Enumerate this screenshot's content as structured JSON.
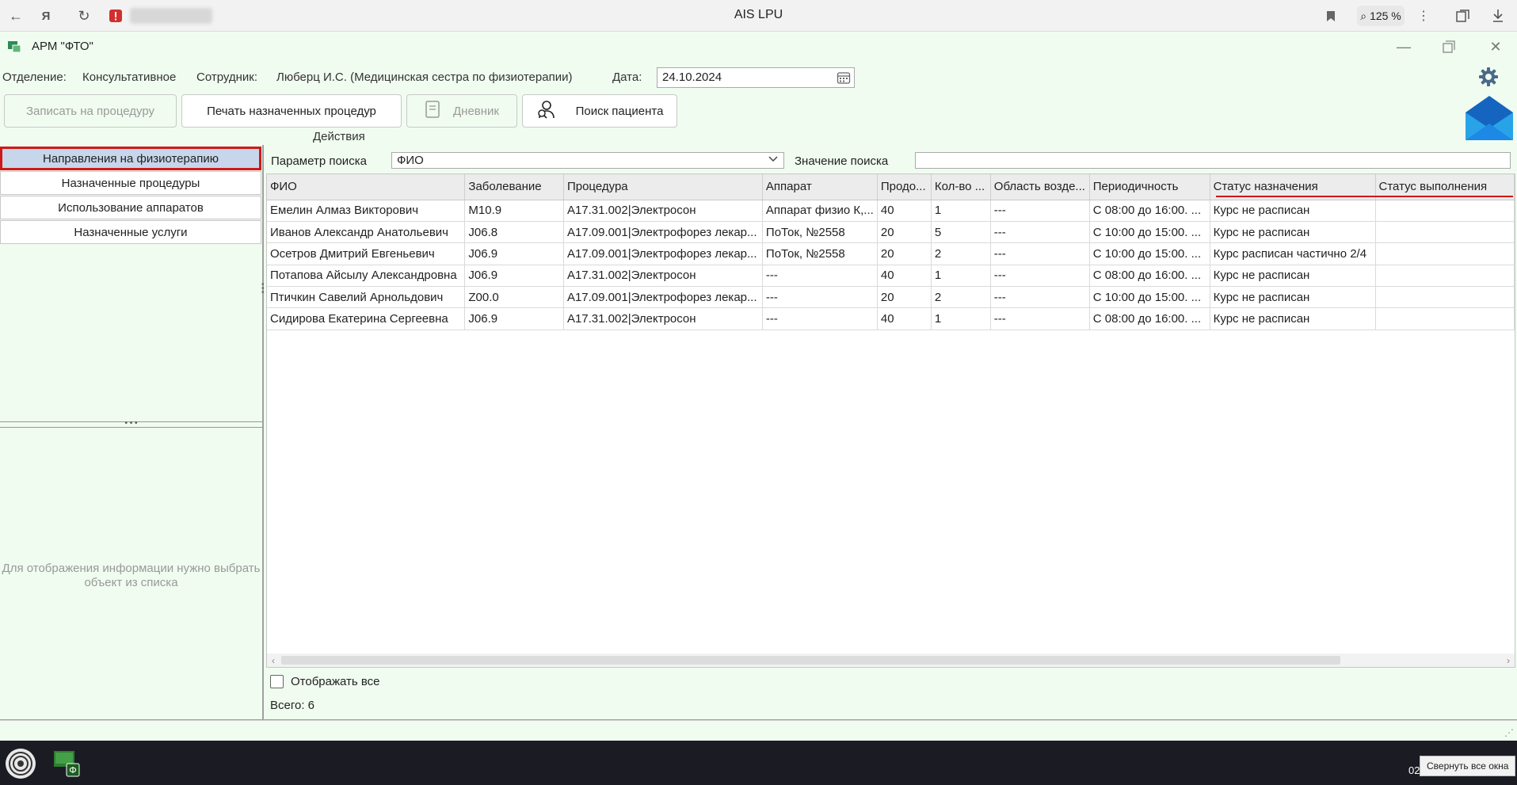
{
  "browser": {
    "title": "AIS LPU",
    "zoom": "125 %"
  },
  "app": {
    "title": "АРМ \"ФТО\""
  },
  "info": {
    "department_label": "Отделение:",
    "department_value": "Консультативное",
    "employee_label": "Сотрудник:",
    "employee_value": "Люберц И.С. (Медицинская сестра по физиотерапии)",
    "date_label": "Дата:",
    "date_value": "24.10.2024"
  },
  "toolbar": {
    "schedule_label": "Записать на процедуру",
    "print_label": "Печать назначенных процедур",
    "diary_label": "Дневник",
    "search_patient_label": "Поиск пациента",
    "group_label": "Действия"
  },
  "nav": {
    "items": [
      {
        "label": "Направления на физиотерапию"
      },
      {
        "label": "Назначенные процедуры"
      },
      {
        "label": "Использование аппаратов"
      },
      {
        "label": "Назначенные услуги"
      }
    ]
  },
  "detail": {
    "hint": "Для отображения информации нужно выбрать объект из списка"
  },
  "search": {
    "param_label": "Параметр поиска",
    "param_value": "ФИО",
    "value_label": "Значение поиска",
    "value": ""
  },
  "table": {
    "columns": [
      "ФИО",
      "Заболевание",
      "Процедура",
      "Аппарат",
      "Продо...",
      "Кол-во ...",
      "Область возде...",
      "Периодичность",
      "Статус назначения",
      "Статус выполнения"
    ],
    "rows": [
      [
        "Емелин Алмаз Викторович",
        "M10.9",
        "A17.31.002|Электросон",
        "Аппарат физио К,...",
        "40",
        "1",
        "---",
        "С 08:00 до 16:00. ...",
        "Курс не расписан",
        ""
      ],
      [
        "Иванов Александр Анатольевич",
        "J06.8",
        "A17.09.001|Электрофорез лекар...",
        "ПоТок, №2558",
        "20",
        "5",
        "---",
        "С 10:00 до 15:00. ...",
        "Курс не расписан",
        ""
      ],
      [
        "Осетров Дмитрий Евгеньевич",
        "J06.9",
        "A17.09.001|Электрофорез лекар...",
        "ПоТок, №2558",
        "20",
        "2",
        "---",
        "С 10:00 до 15:00. ...",
        "Курс расписан частично 2/4",
        ""
      ],
      [
        "Потапова Айсылу Александровна",
        "J06.9",
        "A17.31.002|Электросон",
        "---",
        "40",
        "1",
        "---",
        "С 08:00 до 16:00. ...",
        "Курс не расписан",
        ""
      ],
      [
        "Птичкин Савелий Арнольдович",
        "Z00.0",
        "A17.09.001|Электрофорез лекар...",
        "---",
        "20",
        "2",
        "---",
        "С 10:00 до 15:00. ...",
        "Курс не расписан",
        ""
      ],
      [
        "Сидирова Екатерина Сергеевна",
        "J06.9",
        "A17.31.002|Электросон",
        "---",
        "40",
        "1",
        "---",
        "С 08:00 до 16:00. ...",
        "Курс не расписан",
        ""
      ]
    ]
  },
  "footer": {
    "show_all_label": "Отображать все",
    "total_label": "Всего:  6"
  },
  "taskbar": {
    "hide_all_label": "Свернуть все окна",
    "clock": "02"
  },
  "colors": {
    "app_background": "#f0fcf0",
    "active_nav_fill": "#c7d6ea",
    "highlight_red": "#d01818"
  }
}
